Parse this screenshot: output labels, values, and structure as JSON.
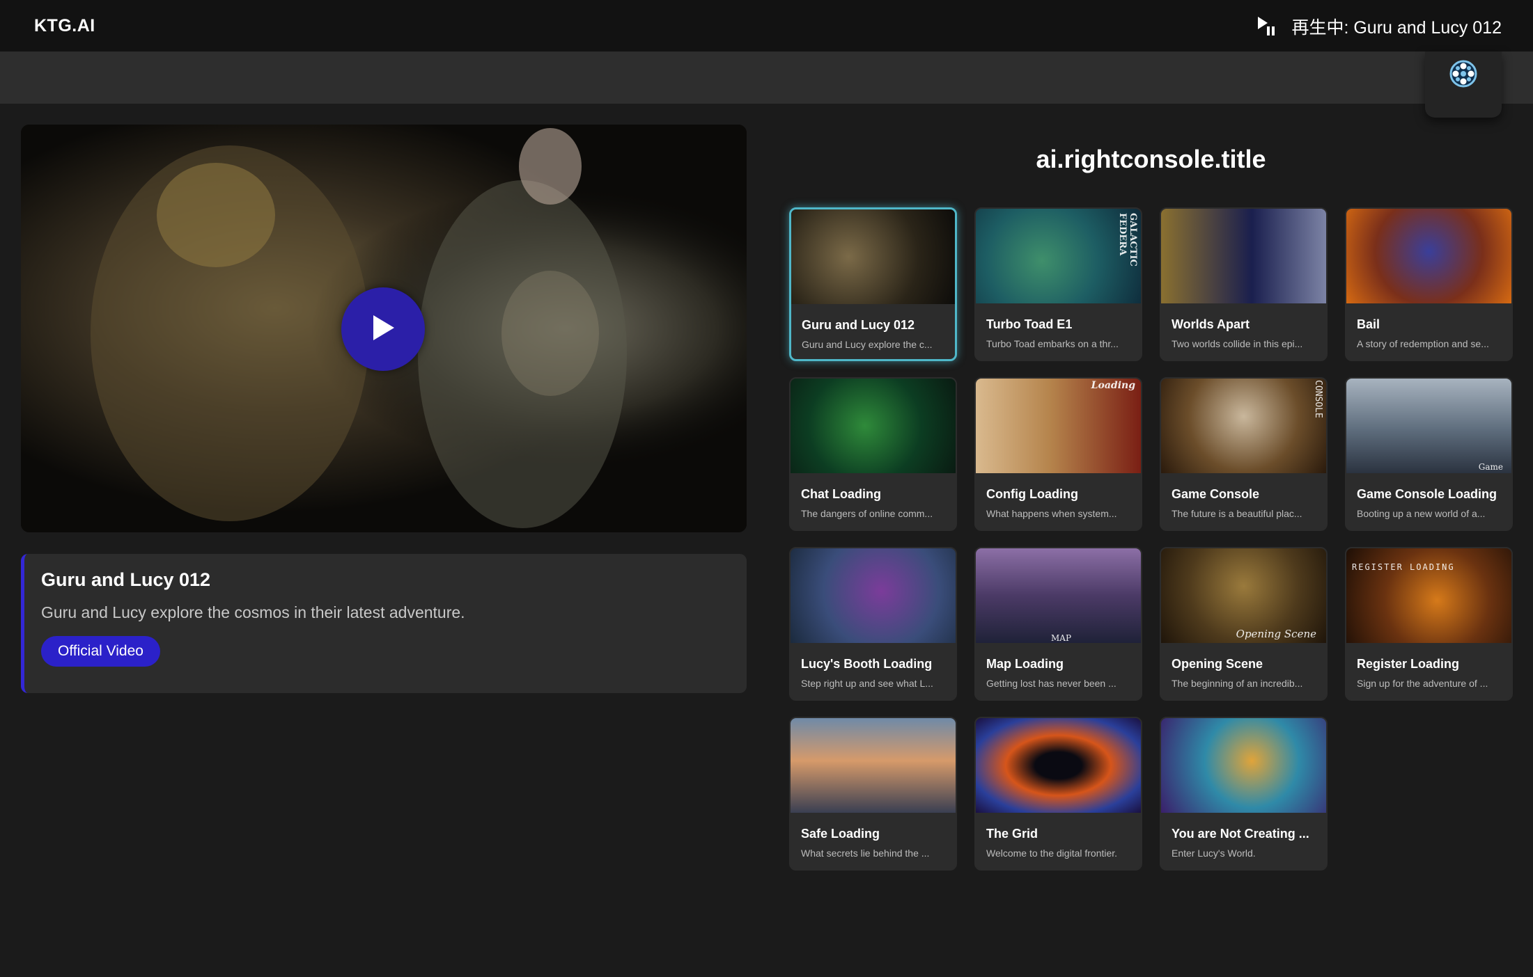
{
  "app": {
    "brand": "KTG.AI"
  },
  "now_playing": {
    "text": "再生中: Guru and Lucy 012",
    "icon": "play-pause-icon"
  },
  "film_button": {
    "icon": "film-reel-icon"
  },
  "player": {
    "play_icon": "play-icon"
  },
  "featured": {
    "title": "Guru and Lucy 012",
    "description": "Guru and Lucy explore the cosmos in their latest adventure.",
    "button_label": "Official Video"
  },
  "console": {
    "title": "ai.rightconsole.title",
    "cards": [
      {
        "title": "Guru and Lucy 012",
        "desc": "Guru and Lucy explore the c...",
        "thumb_text": ""
      },
      {
        "title": "Turbo Toad E1",
        "desc": "Turbo Toad embarks on a thr...",
        "thumb_text": "GALACTIC FEDERA"
      },
      {
        "title": "Worlds Apart",
        "desc": "Two worlds collide in this epi...",
        "thumb_text": ""
      },
      {
        "title": "Bail",
        "desc": "A story of redemption and se...",
        "thumb_text": ""
      },
      {
        "title": "Chat Loading",
        "desc": "The dangers of online comm...",
        "thumb_text": ""
      },
      {
        "title": "Config Loading",
        "desc": "What happens when system...",
        "thumb_text": "Loading"
      },
      {
        "title": "Game Console",
        "desc": "The future is a beautiful plac...",
        "thumb_text": "CONSOLE"
      },
      {
        "title": "Game Console Loading",
        "desc": "Booting up a new world of a...",
        "thumb_text": "Game"
      },
      {
        "title": "Lucy's Booth Loading",
        "desc": "Step right up and see what L...",
        "thumb_text": ""
      },
      {
        "title": "Map Loading",
        "desc": "Getting lost has never been ...",
        "thumb_text": "MAP"
      },
      {
        "title": "Opening Scene",
        "desc": "The beginning of an incredib...",
        "thumb_text": "Opening Scene"
      },
      {
        "title": "Register Loading",
        "desc": "Sign up for the adventure of ...",
        "thumb_text": "REGISTER LOADING"
      },
      {
        "title": "Safe Loading",
        "desc": "What secrets lie behind the ...",
        "thumb_text": ""
      },
      {
        "title": "The Grid",
        "desc": "Welcome to the digital frontier.",
        "thumb_text": ""
      },
      {
        "title": "You are Not Creating ...",
        "desc": "Enter Lucy's World.",
        "thumb_text": ""
      }
    ]
  },
  "colors": {
    "accent": "#2b21c9",
    "active_border": "#4fb7c9",
    "background": "#1b1b1b",
    "card": "#2c2c2c"
  }
}
